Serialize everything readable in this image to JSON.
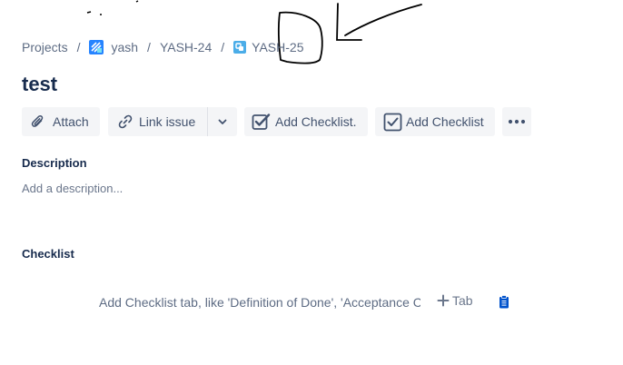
{
  "breadcrumb": {
    "projects": "Projects",
    "project": "yash",
    "parent_issue": "YASH-24",
    "issue": "YASH-25",
    "separator": "/"
  },
  "issue": {
    "title": "test"
  },
  "toolbar": {
    "attach": "Attach",
    "link_issue": "Link issue",
    "add_checklist_dot": "Add Checklist.",
    "add_checklist": "Add Checklist",
    "more_icon": "ellipsis-icon"
  },
  "description": {
    "label": "Description",
    "placeholder": "Add a description..."
  },
  "checklist": {
    "label": "Checklist",
    "input_placeholder": "Add Checklist tab, like 'Definition of Done', 'Acceptance Criteria'",
    "add_tab": "Tab"
  },
  "colors": {
    "project_icon": "#2684ff",
    "subtask_icon": "#4bade8",
    "clipboard_icon": "#0052cc",
    "button_bg": "#f4f5f7"
  }
}
